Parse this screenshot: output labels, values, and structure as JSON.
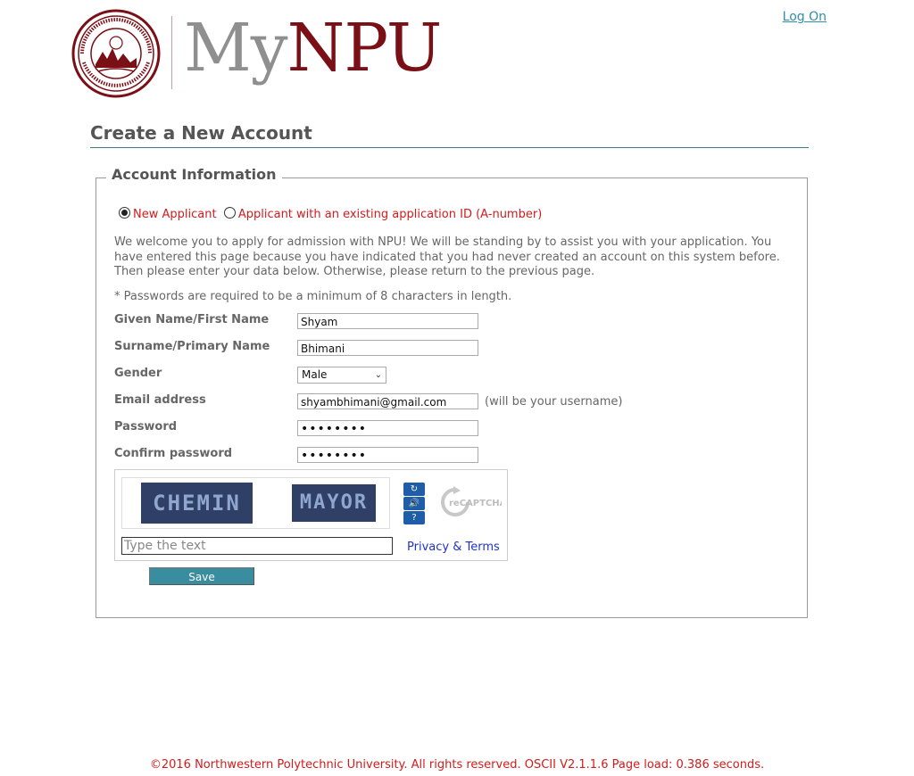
{
  "header": {
    "brand_my": "My",
    "brand_npu": "NPU",
    "logon_label": "Log On"
  },
  "page": {
    "title": "Create a New Account"
  },
  "account_info": {
    "legend": "Account Information",
    "radio_new": "New Applicant",
    "radio_existing": "Applicant with an existing application ID (A-number)",
    "selected": "New Applicant",
    "welcome_text": "We welcome you to apply for admission with NPU! We will be standing by to assist you with your application. You have entered this page because you have indicated that you had never created an account on this system before. Then please enter your data below. Otherwise, please return to the previous page.",
    "password_note": "* Passwords are required to be a minimum of 8 characters in length."
  },
  "form": {
    "given_name_label": "Given Name/First Name",
    "given_name_value": "Shyam",
    "surname_label": "Surname/Primary Name",
    "surname_value": "Bhimani",
    "gender_label": "Gender",
    "gender_value": "Male",
    "email_label": "Email address",
    "email_value": "shyambhimani@gmail.com",
    "email_note": "(will be your username)",
    "password_label": "Password",
    "password_value": "••••••••",
    "confirm_label": "Confirm password",
    "confirm_value": "••••••••"
  },
  "captcha": {
    "word1": "CHEMIN",
    "word2": "MAYOR",
    "placeholder": "Type the text",
    "privacy_link": "Privacy & Terms",
    "logo_text": "reCAPTCHA",
    "refresh_icon": "refresh-icon",
    "audio_icon": "audio-icon",
    "help_icon": "help-icon"
  },
  "actions": {
    "save_label": "Save"
  },
  "footer": {
    "text": "©2016 Northwestern Polytechnic University. All rights reserved. OSCII V2.1.1.6 Page load: 0.386 seconds."
  },
  "colors": {
    "brand_red": "#7a1016",
    "teal": "#3a8c9f",
    "link_teal": "#2f8fa8",
    "error_red": "#d41b1b"
  }
}
